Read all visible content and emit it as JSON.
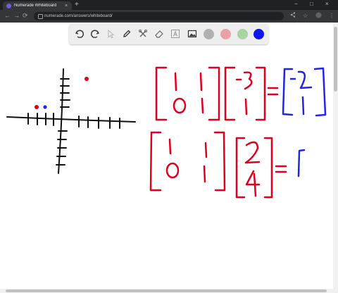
{
  "browser": {
    "tab_title": "Numerade Whiteboard",
    "tab_close": "×",
    "new_tab": "+",
    "url": "numerade.com/answers/whiteboard/",
    "back": "←",
    "forward": "→",
    "reload": "⟳",
    "window_min": "−",
    "window_max": "□",
    "window_close": "×",
    "share_icon": "share-icon",
    "star_icon": "star-icon",
    "menu_icon": "more-vert-icon"
  },
  "toolbar": {
    "tools": [
      "undo-icon",
      "redo-icon",
      "select-icon",
      "pen-icon",
      "tools-icon",
      "eraser-icon",
      "text-icon",
      "image-icon"
    ],
    "colors": [
      {
        "name": "gray",
        "hex": "#b0b0b0"
      },
      {
        "name": "pink",
        "hex": "#eaa1a8"
      },
      {
        "name": "light-green",
        "hex": "#a7d5a0"
      },
      {
        "name": "blue",
        "hex": "#0a14f5"
      }
    ]
  },
  "whiteboard": {
    "ink_colors": {
      "black": "#111111",
      "red": "#e0001b",
      "blue": "#1f26e8"
    },
    "equation_1": {
      "matrix": [
        [
          "1",
          "1"
        ],
        [
          "0",
          "1"
        ]
      ],
      "vector": [
        "-3",
        "1"
      ],
      "equals": "=",
      "result": [
        "-2",
        "1"
      ]
    },
    "equation_2": {
      "matrix": [
        [
          "1",
          "1"
        ],
        [
          "0",
          "1"
        ]
      ],
      "vector": [
        "2",
        "4"
      ],
      "equals": "="
    }
  }
}
